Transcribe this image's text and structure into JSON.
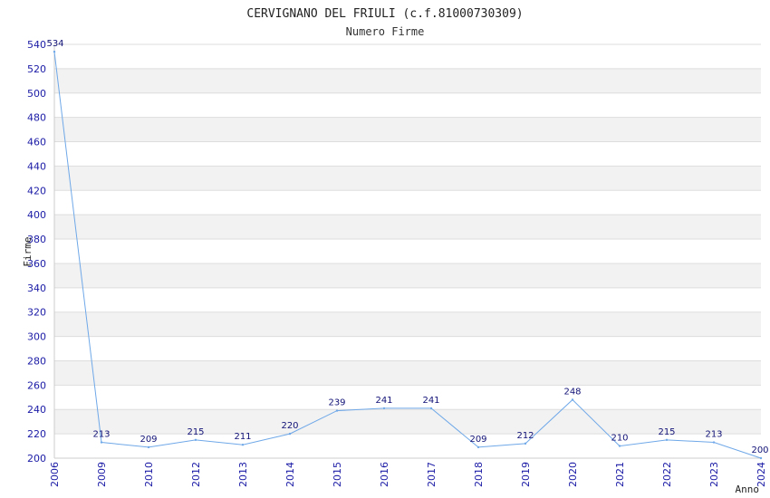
{
  "chart_data": {
    "type": "line",
    "title": "CERVIGNANO DEL FRIULI (c.f.81000730309)",
    "subtitle": "Numero Firme",
    "xlabel": "Anno",
    "ylabel": "Firme",
    "x": [
      "2006",
      "2009",
      "2010",
      "2012",
      "2013",
      "2014",
      "2015",
      "2016",
      "2017",
      "2018",
      "2019",
      "2020",
      "2021",
      "2022",
      "2023",
      "2024"
    ],
    "values": [
      534,
      213,
      209,
      215,
      211,
      220,
      239,
      241,
      241,
      209,
      212,
      248,
      210,
      215,
      213,
      200
    ],
    "ylim": [
      200,
      540
    ],
    "yticks": [
      200,
      220,
      240,
      260,
      280,
      300,
      320,
      340,
      360,
      380,
      400,
      420,
      440,
      460,
      480,
      500,
      520,
      540
    ],
    "grid": true,
    "grid_style": "alternating horizontal bands",
    "colors": {
      "line": "#6fa8e8",
      "band": "#f2f2f2",
      "gridline": "#dddddd",
      "tick_text": "#1a1aa6",
      "data_label": "#111177"
    }
  }
}
